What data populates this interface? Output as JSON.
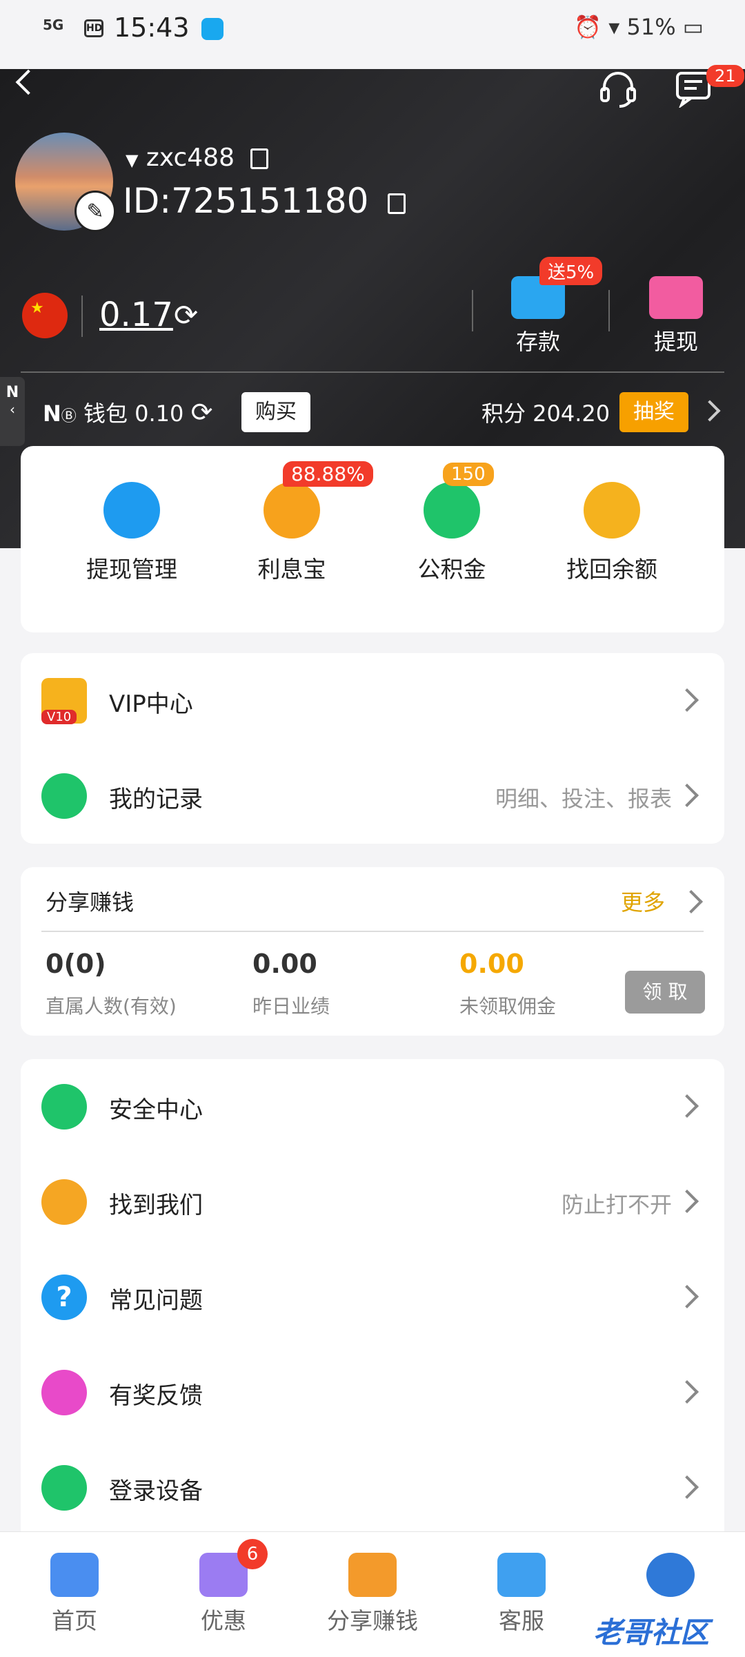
{
  "status_bar": {
    "signal": "5G",
    "hd": "HD",
    "time": "15:43",
    "right": "⏰ ▾ 51% ▭"
  },
  "header": {
    "message_badge": "21"
  },
  "profile": {
    "username": "zxc488",
    "user_id": "ID:725151180"
  },
  "balance": {
    "amount": "0.17"
  },
  "quick_actions": [
    {
      "label": "存款",
      "badge": "送5%",
      "icon": "deposit-wallet-icon",
      "color": "#2aa6f0"
    },
    {
      "label": "提现",
      "icon": "withdraw-card-icon",
      "color": "#f25ca0"
    }
  ],
  "wallet_bar": {
    "side_tab": "N",
    "nb_logo": "N",
    "wallet_text": "钱包 0.10",
    "buy_label": "购买",
    "points_text": "积分 204.20",
    "lottery_label": "抽奖"
  },
  "services": [
    {
      "label": "提现管理",
      "icon": "card-icon",
      "color": "#1e9bf0"
    },
    {
      "label": "利息宝",
      "badge": "88.88%",
      "icon": "piggy-bank-icon",
      "color": "#f7a21c"
    },
    {
      "label": "公积金",
      "badge": "150",
      "icon": "fund-icon",
      "color": "#1fc46a"
    },
    {
      "label": "找回余额",
      "icon": "coin-search-icon",
      "color": "#f5b21e"
    }
  ],
  "menu_top": [
    {
      "label": "VIP中心",
      "sub": "",
      "icon": "vip-crown-icon",
      "badge": "V10",
      "color": "#f6b21d"
    },
    {
      "label": "我的记录",
      "sub": "明细、投注、报表",
      "icon": "clipboard-icon",
      "color": "#1fc46a"
    }
  ],
  "share": {
    "title": "分享赚钱",
    "more": "更多",
    "stats": [
      {
        "value": "0(0)",
        "label": "直属人数(有效)"
      },
      {
        "value": "0.00",
        "label": "昨日业绩"
      },
      {
        "value": "0.00",
        "label": "未领取佣金"
      }
    ],
    "claim_label": "领 取"
  },
  "menu_bottom": [
    {
      "label": "安全中心",
      "sub": "",
      "icon": "shield-check-icon",
      "color": "#1fc46a"
    },
    {
      "label": "找到我们",
      "sub": "防止打不开",
      "icon": "search-coin-icon",
      "color": "#f5a623"
    },
    {
      "label": "常见问题",
      "sub": "",
      "icon": "question-icon",
      "color": "#1e9bf0"
    },
    {
      "label": "有奖反馈",
      "sub": "",
      "icon": "gift-icon",
      "color": "#e84ac9"
    },
    {
      "label": "登录设备",
      "sub": "",
      "icon": "devices-icon",
      "color": "#1fc46a"
    }
  ],
  "tabbar": [
    {
      "label": "首页",
      "icon": "home-icon"
    },
    {
      "label": "优惠",
      "icon": "gift-box-icon",
      "badge": "6"
    },
    {
      "label": "分享赚钱",
      "icon": "share-money-icon"
    },
    {
      "label": "客服",
      "icon": "chat-bubbles-icon"
    },
    {
      "label": "",
      "icon": "profile-icon"
    }
  ],
  "watermark": "老哥社区"
}
